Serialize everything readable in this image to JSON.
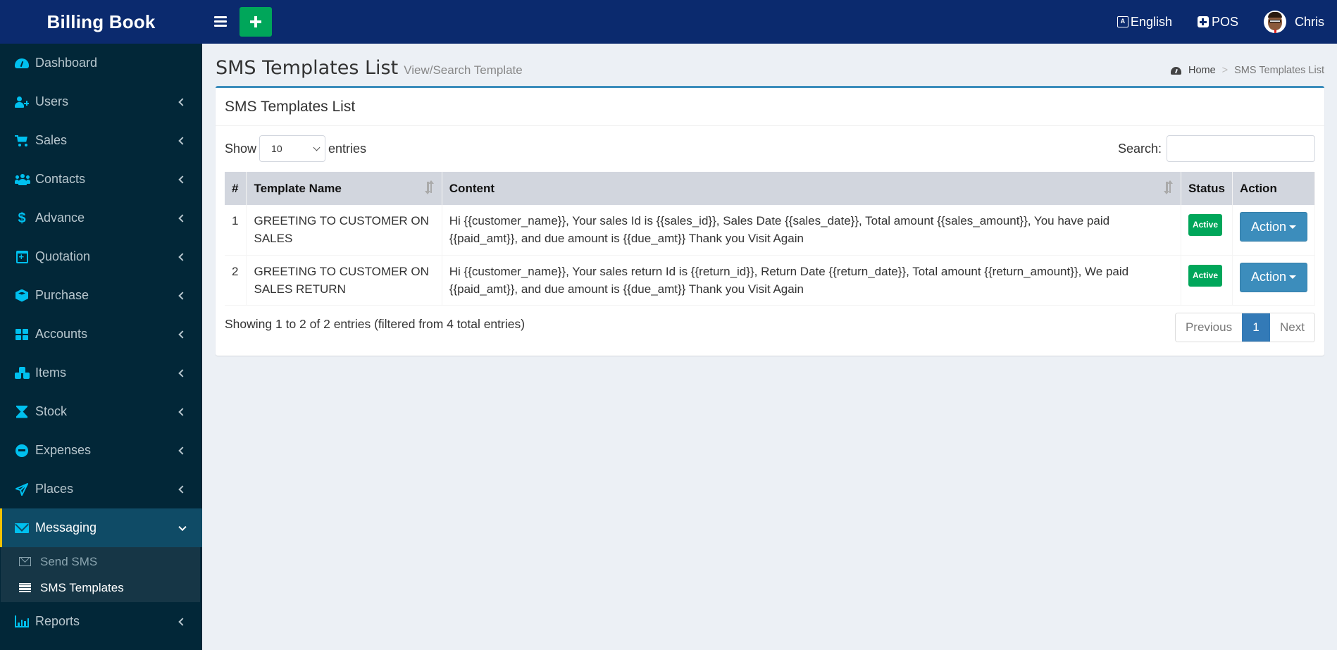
{
  "app": {
    "title": "Billing Book",
    "add_button_icon": "plus-icon",
    "menu_toggle_icon": "hamburger-icon"
  },
  "topnav": {
    "language": "English",
    "pos": "POS",
    "user": "Chris"
  },
  "sidebar": {
    "items": [
      {
        "label": "Dashboard",
        "icon": "dashboard-icon"
      },
      {
        "label": "Users",
        "icon": "user-plus-icon"
      },
      {
        "label": "Sales",
        "icon": "cart-icon"
      },
      {
        "label": "Contacts",
        "icon": "users-icon"
      },
      {
        "label": "Advance",
        "icon": "dollar-icon"
      },
      {
        "label": "Quotation",
        "icon": "calendar-plus-icon"
      },
      {
        "label": "Purchase",
        "icon": "cube-icon"
      },
      {
        "label": "Accounts",
        "icon": "grid-icon"
      },
      {
        "label": "Items",
        "icon": "cubes-icon"
      },
      {
        "label": "Stock",
        "icon": "hourglass-icon"
      },
      {
        "label": "Expenses",
        "icon": "minus-circle-icon"
      },
      {
        "label": "Places",
        "icon": "paper-plane-icon"
      },
      {
        "label": "Messaging",
        "icon": "envelope-icon",
        "active": true
      },
      {
        "label": "Reports",
        "icon": "bar-chart-icon"
      }
    ],
    "messaging_submenu": [
      {
        "label": "Send SMS",
        "icon": "envelope-outline-icon"
      },
      {
        "label": "SMS Templates",
        "icon": "list-icon",
        "current": true
      }
    ]
  },
  "page": {
    "title": "SMS Templates List",
    "subtitle": "View/Search Template",
    "breadcrumb": {
      "home": "Home",
      "separator": ">",
      "current": "SMS Templates List"
    }
  },
  "box": {
    "title": "SMS Templates List",
    "show_label": "Show",
    "entries_label": "entries",
    "page_length": "10",
    "search_label": "Search:",
    "search_value": ""
  },
  "table": {
    "columns": [
      "#",
      "Template Name",
      "Content",
      "Status",
      "Action"
    ],
    "rows": [
      {
        "num": "1",
        "name": "GREETING TO CUSTOMER ON SALES",
        "content": "Hi {{customer_name}}, Your sales Id is {{sales_id}}, Sales Date {{sales_date}}, Total amount {{sales_amount}}, You have paid {{paid_amt}}, and due amount is {{due_amt}} Thank you Visit Again",
        "status": "Active",
        "action": "Action"
      },
      {
        "num": "2",
        "name": "GREETING TO CUSTOMER ON SALES RETURN",
        "content": "Hi {{customer_name}}, Your sales return Id is {{return_id}}, Return Date {{return_date}}, Total amount {{return_amount}}, We paid {{paid_amt}}, and due amount is {{due_amt}} Thank you Visit Again",
        "status": "Active",
        "action": "Action"
      }
    ]
  },
  "footer": {
    "info": "Showing 1 to 2 of 2 entries (filtered from 4 total entries)",
    "previous": "Previous",
    "current_page": "1",
    "next": "Next"
  },
  "colors": {
    "header_bg": "#0b2a6e",
    "sidebar_bg": "#022738",
    "accent": "#00c0ef",
    "active_label": "#00a65a",
    "primary_button": "#3c8dbc",
    "active_indicator": "#f3c200"
  }
}
